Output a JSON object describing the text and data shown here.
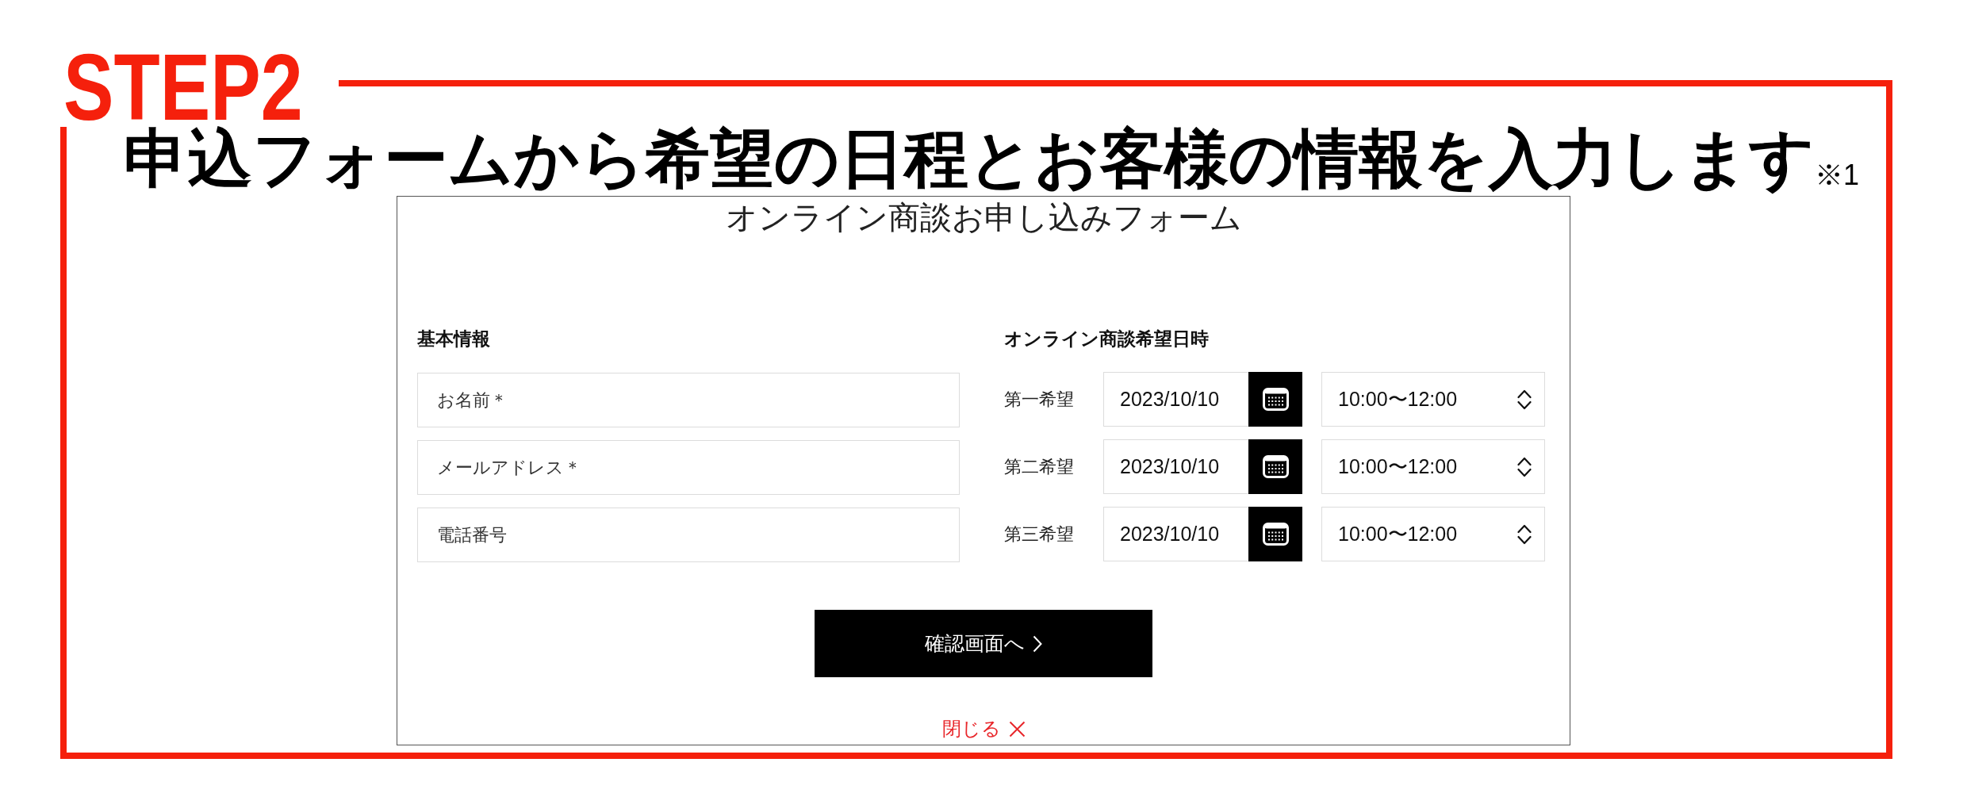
{
  "step_label": "STEP2",
  "heading": {
    "text": "申込フォームから希望の日程とお客様の情報を入力します",
    "note_mark": "※1"
  },
  "form": {
    "title": "オンライン商談お申し込みフォーム",
    "basic_info": {
      "heading": "基本情報",
      "fields": [
        {
          "placeholder": "お名前＊"
        },
        {
          "placeholder": "メールアドレス＊"
        },
        {
          "placeholder": "電話番号"
        }
      ]
    },
    "schedule": {
      "heading": "オンライン商談希望日時",
      "preferences": [
        {
          "label": "第一希望",
          "date": "2023/10/10",
          "time": "10:00〜12:00"
        },
        {
          "label": "第二希望",
          "date": "2023/10/10",
          "time": "10:00〜12:00"
        },
        {
          "label": "第三希望",
          "date": "2023/10/10",
          "time": "10:00〜12:00"
        }
      ]
    },
    "submit_button": {
      "label": "確認画面へ"
    },
    "close_link": {
      "label": "閉じる"
    }
  }
}
